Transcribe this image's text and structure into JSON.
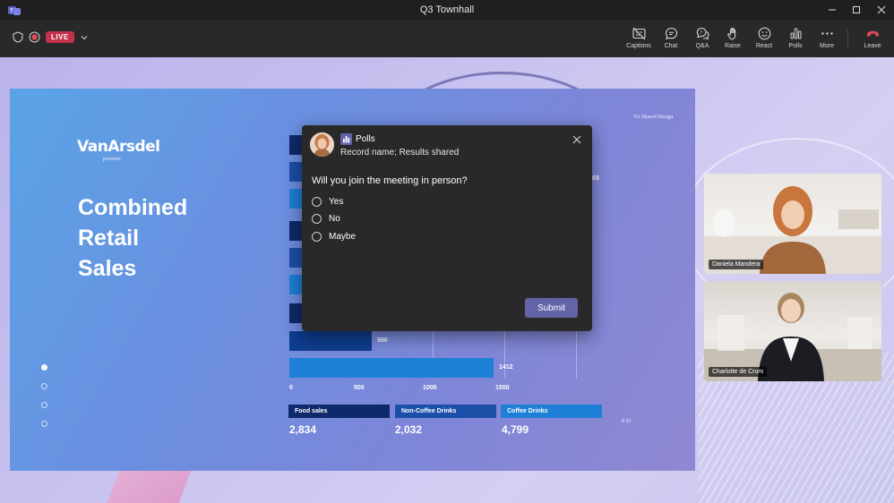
{
  "window": {
    "title": "Q3 Townhall"
  },
  "toolbar": {
    "live_label": "LIVE",
    "buttons": [
      {
        "label": "Captions",
        "icon": "captions-icon"
      },
      {
        "label": "Chat",
        "icon": "chat-icon"
      },
      {
        "label": "Q&A",
        "icon": "qa-icon"
      },
      {
        "label": "Raise",
        "icon": "raise-hand-icon"
      },
      {
        "label": "React",
        "icon": "react-icon"
      },
      {
        "label": "Polls",
        "icon": "polls-icon"
      },
      {
        "label": "More",
        "icon": "more-icon"
      }
    ],
    "leave_label": "Leave",
    "leave_color": "#c4314b"
  },
  "slide": {
    "brand": "VanArsdel",
    "brand_sub": "presents",
    "title_lines": [
      "Combined",
      "Retail",
      "Sales"
    ],
    "corner_note": "VA Shared Design",
    "page": "P 01",
    "visible_bar_labels": {
      "partial": "03",
      "bar_590": "590",
      "bar_1412": "1412"
    },
    "axis_ticks": [
      "0",
      "500",
      "1000",
      "1500"
    ],
    "legend": [
      {
        "label": "Food sales",
        "value": "2,834",
        "color": "#0f2a6b"
      },
      {
        "label": "Non-Coffee Drinks",
        "value": "2,032",
        "color": "#1b4fa8"
      },
      {
        "label": "Coffee Drinks",
        "value": "4,799",
        "color": "#1e7fd6"
      }
    ]
  },
  "chart_data": {
    "type": "bar",
    "orientation": "horizontal",
    "x_ticks": [
      0,
      500,
      1000,
      1500
    ],
    "visible_values": [
      590,
      1412
    ]
  },
  "poll": {
    "app_name": "Polls",
    "subtitle": "Record name; Results shared",
    "question": "Will you join the meeting in person?",
    "options": [
      "Yes",
      "No",
      "Maybe"
    ],
    "submit_label": "Submit",
    "accent": "#6264a7"
  },
  "participants": [
    {
      "name": "Daniela Mandera"
    },
    {
      "name": "Charlotte de Crum"
    }
  ]
}
